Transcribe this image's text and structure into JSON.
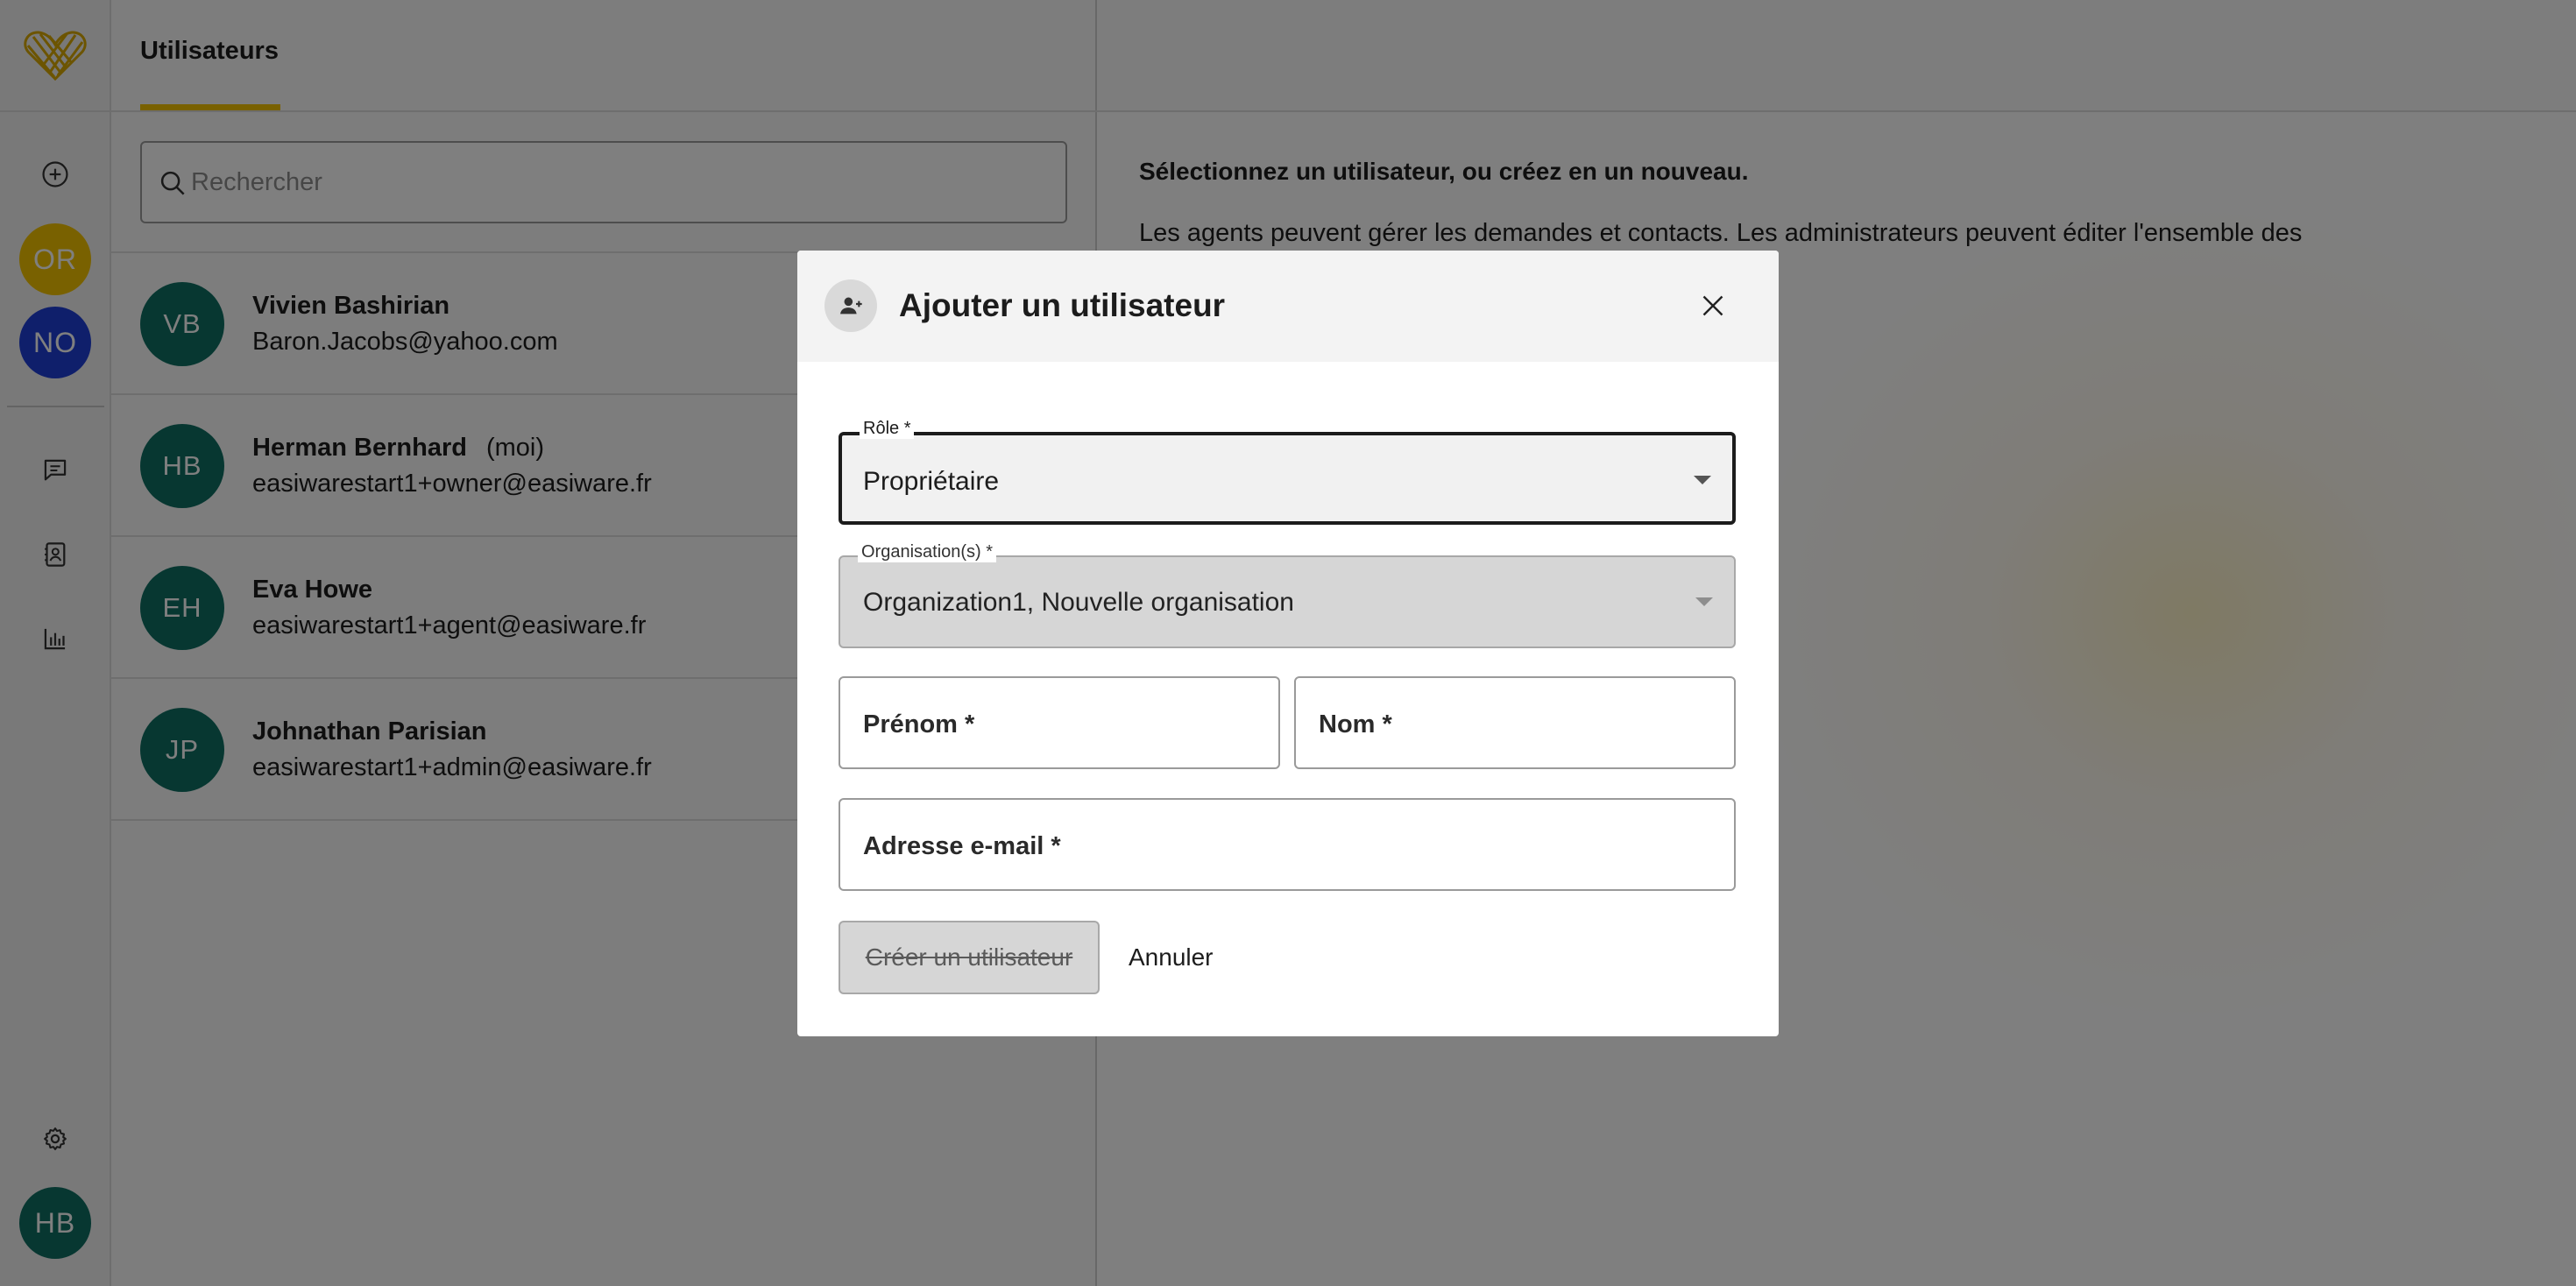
{
  "app": {
    "accent_color": "#f2c200",
    "logo_icon": "heart-logo"
  },
  "rail": {
    "avatars": [
      {
        "initials": "OR",
        "color": "#f2c200"
      },
      {
        "initials": "NO",
        "color": "#1f3fd6"
      }
    ],
    "profile": {
      "initials": "HB",
      "color": "#0f6e63"
    },
    "icons": [
      "add-circle-icon",
      "chat-icon",
      "contacts-icon",
      "stats-icon",
      "gear-icon"
    ]
  },
  "users_panel": {
    "tab_label": "Utilisateurs",
    "search_placeholder": "Rechercher",
    "users": [
      {
        "initials": "VB",
        "name": "Vivien Bashirian",
        "me": "",
        "email": "Baron.Jacobs@yahoo.com"
      },
      {
        "initials": "HB",
        "name": "Herman Bernhard",
        "me": "(moi)",
        "email": "easiwarestart1+owner@easiware.fr"
      },
      {
        "initials": "EH",
        "name": "Eva Howe",
        "me": "",
        "email": "easiwarestart1+agent@easiware.fr"
      },
      {
        "initials": "JP",
        "name": "Johnathan Parisian",
        "me": "",
        "email": "easiwarestart1+admin@easiware.fr"
      }
    ]
  },
  "detail": {
    "title": "Sélectionnez un utilisateur, ou créez en un nouveau.",
    "text": "Les agents peuvent gérer les demandes et contacts. Les administrateurs peuvent éditer l'ensemble des"
  },
  "modal": {
    "title": "Ajouter un utilisateur",
    "role_label": "Rôle *",
    "role_value": "Propriétaire",
    "org_label": "Organisation(s) *",
    "org_value": "Organization1, Nouvelle organisation",
    "first_name_placeholder": "Prénom *",
    "last_name_placeholder": "Nom *",
    "email_placeholder": "Adresse e-mail *",
    "create_label": "Créer un utilisateur",
    "cancel_label": "Annuler"
  }
}
